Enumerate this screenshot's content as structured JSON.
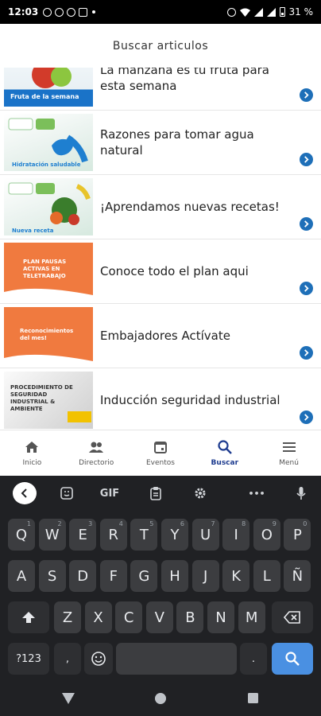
{
  "status": {
    "time": "12:03",
    "battery": "31 %"
  },
  "header": {
    "title": "Buscar articulos"
  },
  "articles": [
    {
      "title": "La manzana es tu fruta para esta semana",
      "thumb_text": "Fruta de la semana"
    },
    {
      "title": "Razones para tomar agua natural",
      "thumb_text": "Hidratación saludable"
    },
    {
      "title": "¡Aprendamos nuevas recetas!",
      "thumb_text": "Nueva receta"
    },
    {
      "title": "Conoce todo el plan aqui",
      "thumb_text": "PLAN PAUSAS ACTIVAS EN TELETRABAJO"
    },
    {
      "title": "Embajadores Actívate",
      "thumb_text": "Reconocimientos del mes!"
    },
    {
      "title": "Inducción seguridad industrial",
      "thumb_text": "PROCEDIMIENTO DE SEGURIDAD INDUSTRIAL & AMBIENTE"
    }
  ],
  "bottom_nav": [
    {
      "label": "Inicio",
      "icon": "home-icon"
    },
    {
      "label": "Directorio",
      "icon": "people-icon"
    },
    {
      "label": "Eventos",
      "icon": "calendar-icon"
    },
    {
      "label": "Buscar",
      "icon": "search-icon",
      "active": true
    },
    {
      "label": "Menú",
      "icon": "menu-icon"
    }
  ],
  "keyboard": {
    "toolbar": {
      "gif": "GIF",
      "more": "•••"
    },
    "row1": [
      "Q",
      "W",
      "E",
      "R",
      "T",
      "Y",
      "U",
      "I",
      "O",
      "P"
    ],
    "row1_hints": [
      "1",
      "2",
      "3",
      "4",
      "5",
      "6",
      "7",
      "8",
      "9",
      "0"
    ],
    "row2": [
      "A",
      "S",
      "D",
      "F",
      "G",
      "H",
      "J",
      "K",
      "L",
      "Ñ"
    ],
    "row3": [
      "Z",
      "X",
      "C",
      "V",
      "B",
      "N",
      "M"
    ],
    "symbols": "?123",
    "comma": ",",
    "period": "."
  },
  "colors": {
    "accent": "#1d3b8f",
    "arrow": "#1e6fb8",
    "orange": "#f07a3f",
    "search_key": "#4a90e2"
  }
}
